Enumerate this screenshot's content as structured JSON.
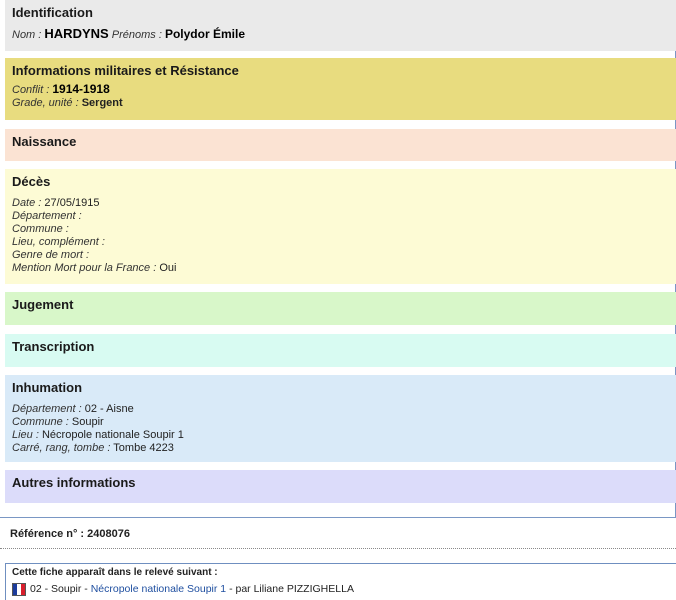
{
  "identification": {
    "title": "Identification",
    "nom_label": "Nom :",
    "nom": "HARDYNS",
    "prenoms_label": "Prénoms :",
    "prenoms": "Polydor Émile"
  },
  "militaire": {
    "title": "Informations militaires et Résistance",
    "conflit_label": "Conflit :",
    "conflit": "1914-1918",
    "grade_label": "Grade, unité :",
    "grade": "Sergent"
  },
  "naissance": {
    "title": "Naissance"
  },
  "deces": {
    "title": "Décès",
    "date_label": "Date :",
    "date": "27/05/1915",
    "departement_label": "Département :",
    "commune_label": "Commune :",
    "lieu_label": "Lieu, complément :",
    "genre_label": "Genre de mort :",
    "mention_label": "Mention Mort pour la France :",
    "mention": "Oui"
  },
  "jugement": {
    "title": "Jugement"
  },
  "transcription": {
    "title": "Transcription"
  },
  "inhumation": {
    "title": "Inhumation",
    "departement_label": "Département :",
    "departement": "02 - Aisne",
    "commune_label": "Commune :",
    "commune": "Soupir",
    "lieu_label": "Lieu :",
    "lieu": "Nécropole nationale Soupir 1",
    "carre_label": "Carré, rang, tombe :",
    "carre": "Tombe 4223"
  },
  "autres": {
    "title": "Autres informations"
  },
  "reference": {
    "label": "Référence n° :",
    "value": "2408076"
  },
  "releve": {
    "heading": "Cette fiche apparaît dans le relevé suivant :",
    "prefix": "02 - Soupir -",
    "link": "Nécropole nationale Soupir 1",
    "suffix": "- par Liliane PIZZIGHELLA",
    "flag_colors": [
      "#1c3c9c",
      "#ffffff",
      "#d81e2c"
    ]
  }
}
